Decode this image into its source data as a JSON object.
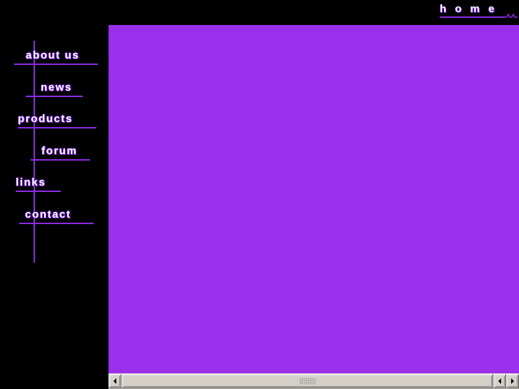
{
  "page": {
    "background_color": "#000000",
    "accent_color": "#8b2be2",
    "content_color": "#9a2fec",
    "text_color": "#ffffff"
  },
  "header": {
    "home_label": "h o m e",
    "home_icon": "squiggle-flourish"
  },
  "sidebar": {
    "items": [
      {
        "label": "about us"
      },
      {
        "label": "news"
      },
      {
        "label": "products"
      },
      {
        "label": "forum"
      },
      {
        "label": "links"
      },
      {
        "label": "contact"
      }
    ]
  },
  "main": {
    "content": ""
  },
  "scrollbar": {
    "left_arrow_icon": "arrow-left-icon",
    "thumb_grip_icon": "grip-dots-icon",
    "right_arrow_back_icon": "arrow-left-icon",
    "right_arrow_forward_icon": "arrow-right-icon"
  }
}
